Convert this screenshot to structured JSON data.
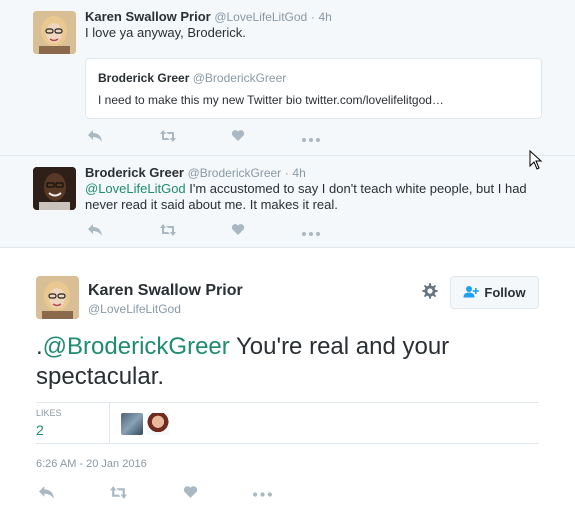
{
  "thread": {
    "replies": [
      {
        "name": "Karen Swallow Prior",
        "handle": "@LoveLifeLitGod",
        "separator": "·",
        "time": "4h",
        "text": "I love ya anyway, Broderick.",
        "quote": {
          "name": "Broderick Greer",
          "handle": "@BroderickGreer",
          "text": "I need to make this my new Twitter bio  twitter.com/lovelifelitgod…"
        }
      },
      {
        "name": "Broderick Greer",
        "handle": "@BroderickGreer",
        "separator": "·",
        "time": "4h",
        "mention": "@LoveLifeLitGod",
        "text": " I'm accustomed to say I don't teach white people, but I had never read it said about me. It makes it real."
      }
    ],
    "action_icons": [
      "reply-icon",
      "retweet-icon",
      "like-icon",
      "more-icon"
    ]
  },
  "main": {
    "name": "Karen Swallow Prior",
    "handle": "@LoveLifeLitGod",
    "follow_label": "Follow",
    "text_prefix": ".",
    "mention": "@BroderickGreer",
    "text": " You're real and your spectacular.",
    "likes_label": "LIKES",
    "likes_count": "2",
    "timestamp": "6:26 AM - 20 Jan 2016"
  },
  "colors": {
    "accent": "#1f8b6f",
    "muted": "#8899a6",
    "icon": "#aab8c2",
    "thread_bg": "#f5f8fa",
    "border": "#e1e8ed"
  }
}
